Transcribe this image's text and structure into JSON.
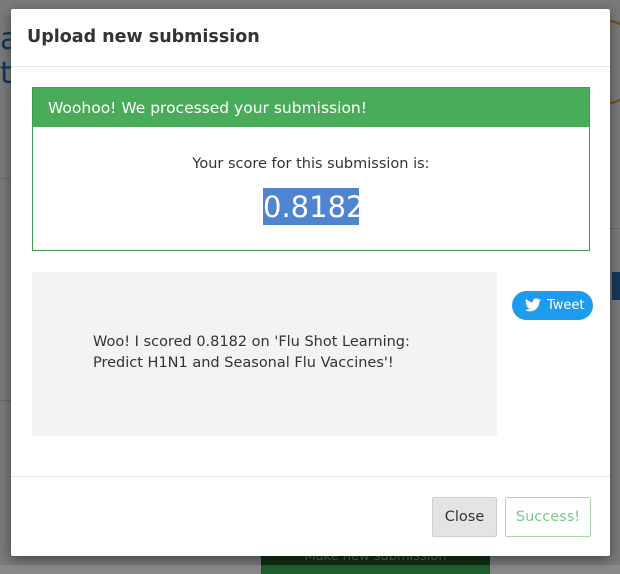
{
  "modal": {
    "title": "Upload new submission",
    "alert_heading": "Woohoo! We processed your submission!",
    "score_label": "Your score for this submission is:",
    "score_value": "0.8182",
    "share_text": "Woo! I scored 0.8182 on 'Flu Shot Learning: Predict H1N1 and Seasonal Flu Vaccines'!",
    "tweet_label": "Tweet",
    "close_label": "Close",
    "success_label": "Success!"
  },
  "background": {
    "submit_label": "Make new submission"
  },
  "colors": {
    "alert_green": "#4aac5b",
    "score_highlight": "#4f84d0",
    "tweet_blue": "#1d9bf0",
    "success_text": "#7ac98a"
  }
}
